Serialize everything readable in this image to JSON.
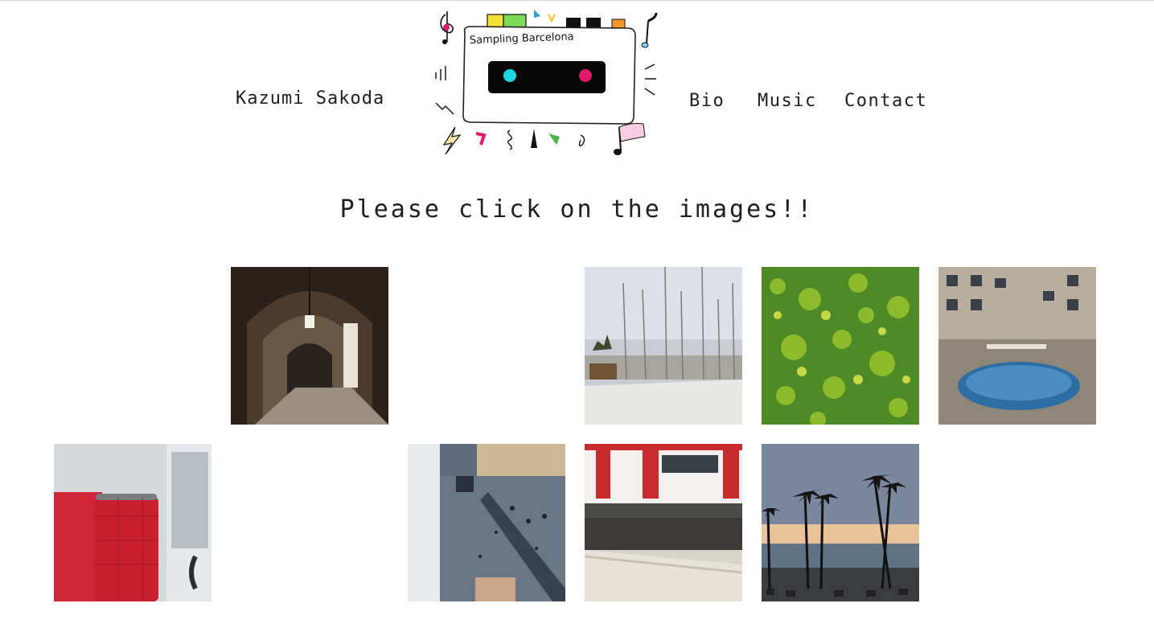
{
  "site": {
    "name": "Kazumi Sakoda",
    "logo_text": "Sampling Barcelona"
  },
  "nav": {
    "items": [
      "Bio",
      "Music",
      "Contact"
    ]
  },
  "main": {
    "heading": "Please click on the images!!"
  },
  "gallery": {
    "tiles": [
      {
        "subject": "stone archway corridor"
      },
      {
        "subject": "sailboat masts at harbor"
      },
      {
        "subject": "green leafy hedge"
      },
      {
        "subject": "courtyard ping-pong table"
      },
      {
        "subject": "red bus seats"
      },
      {
        "subject": "plaza viewed from above"
      },
      {
        "subject": "red and white train at platform"
      },
      {
        "subject": "palm trees at beach sunset"
      }
    ]
  },
  "colors": {
    "text": "#1e1e1e",
    "logo_cyan": "#1ed6e0",
    "logo_magenta": "#e0196b"
  }
}
